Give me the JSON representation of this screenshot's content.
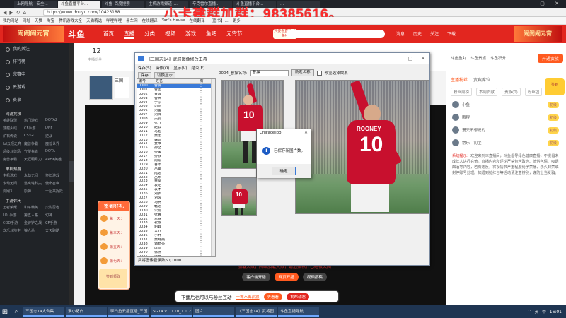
{
  "browser": {
    "tabs": [
      "上网导航—安全...",
      "斗鱼直播平台...",
      "斗鱼_百度搜索",
      "主机游戏频道_...",
      "辛克雷尔直播...",
      "斗鱼直播平台...",
      "..."
    ],
    "active_tab_index": 1,
    "url": "https://www.douyu.com/10423188",
    "nav_back": "◀",
    "nav_fwd": "▶",
    "nav_refresh": "↻",
    "nav_home": "⌂",
    "window_controls": "— ▢ ✕"
  },
  "overlay_text": "小卡建群加群：98385616。",
  "bookmarks": [
    "我的网站",
    "网址",
    "天猫",
    "淘宝",
    "腾讯游戏大全",
    "天猫精选",
    "哔哩哔哩",
    "易车网",
    "在线翻译",
    "Yan's House",
    "在线翻译",
    "【图书】...",
    "更多"
  ],
  "header": {
    "logo": "斗鱼",
    "nav": [
      "首页",
      "直播",
      "分类",
      "视频",
      "游戏",
      "鱼吧",
      "元宵节"
    ],
    "active_nav_index": 1,
    "badge": "只要看直播 上鱼吧",
    "icons": [
      "消息",
      "历史",
      "关注",
      "下载"
    ],
    "banner_left": "闹闹闹元宵",
    "banner_right": "闹闹闹元宵"
  },
  "sidebar": {
    "items": [
      "我的关注",
      "排行榜",
      "完赛中",
      "云游戏",
      "赛事"
    ],
    "section1": "网游竞技",
    "grid1": [
      "英雄联盟",
      "热门游戏",
      "DOTA2",
      "穿越火线",
      "CF手游",
      "DNF",
      "炉石传说",
      "CS:GO",
      "逆战",
      "lol云顶之弈",
      "魔兽争霸",
      "魔兽世界",
      "超级斗兽场",
      "守望先锋",
      "DOTA",
      "魔兽争霸",
      "天涯明月刀",
      "APEX英雄"
    ],
    "section2": "单机热游",
    "grid2": [
      "主机游戏",
      "永劫无间",
      "怀旧游戏",
      "永劫无间",
      "逃离塔科夫",
      "使命召唤",
      "剑网3",
      "原神",
      "一起来捉妖"
    ],
    "section3": "手游休闲",
    "grid3": [
      "王者荣耀",
      "和平精英",
      "火影忍者",
      "LOL手游",
      "第五人格",
      "幻神",
      "COD手游",
      "金铲铲之战",
      "CF手游",
      "欢乐斗地主",
      "狼人杀",
      "天天跑酷"
    ]
  },
  "stream": {
    "fans_count": "12",
    "fans_label": "主播粉丝",
    "thumb_label": "三国"
  },
  "signin": {
    "title": "签到好礼",
    "rows": [
      "第一天：",
      "第三天：",
      "第五天：",
      "第七天："
    ],
    "gift": "签到领取"
  },
  "bottom": {
    "message": "加载失败，网络加载失败，请选择软件已经被关闭",
    "btn1": "客户端开播",
    "btn2": "网页开播",
    "btn3": "视频投稿"
  },
  "promo": {
    "text": "下播后也可以与粉丝互动",
    "link": "一城不再孤独",
    "btn1": "去看看",
    "btn2": "发布动态"
  },
  "right": {
    "top_labels": [
      "斗鱼鱼丸",
      "斗鱼贵族",
      "斗鱼积分"
    ],
    "open_btn": "开通贵族",
    "tabs": [
      "主播粉丝",
      "贵宾席位"
    ],
    "subtabs": [
      "粉丝周榜",
      "本周贡献",
      "贵族(0)",
      "粉丝团"
    ],
    "users": [
      {
        "name": "小鱼",
        "level": "初级"
      },
      {
        "name": "鹏程",
        "level": "初级"
      },
      {
        "name": "漫天不想说的",
        "level": "初级"
      },
      {
        "name": "常乐—初尘",
        "level": "初级"
      }
    ],
    "notice_title": "系统提示：",
    "notice": "欢迎来到本直播间，斗鱼倡导绿色健康直播，不提倡未成年人进行充值。直播内容和评论严禁包含政治、低俗色情、吸烟酗酒等内容，若有违反，将视情节严重程度给予禁播、永久封禁或封停账号处理。如遇到抢红包等活动请注意辨别，谨防上当受骗。",
    "badge": "签到"
  },
  "dialog": {
    "title": "《三国志14》武将图像修改工具",
    "menu": [
      "保存(S)",
      "操作(O)",
      "显示(V)",
      "结束(E)"
    ],
    "toolbar": [
      "保存",
      "切换显示"
    ],
    "columns": [
      "编号",
      "姓名",
      "有"
    ],
    "rows": [
      [
        "0000",
        "曹操",
        "○"
      ],
      [
        "0001",
        "曹丕",
        "○"
      ],
      [
        "0002",
        "曹叡",
        "○"
      ],
      [
        "0003",
        "曹奂",
        "○"
      ],
      [
        "0004",
        "于禁",
        "○"
      ],
      [
        "0005",
        "司马",
        "○"
      ],
      [
        "0006",
        "刘备",
        "○"
      ],
      [
        "0007",
        "刘禅",
        "○"
      ],
      [
        "0008",
        "关羽",
        "○"
      ],
      [
        "0009",
        "张飞",
        "○"
      ],
      [
        "0010",
        "赵云",
        "○"
      ],
      [
        "0011",
        "马超",
        "○"
      ],
      [
        "0012",
        "黄忠",
        "○"
      ],
      [
        "0013",
        "魏延",
        "○"
      ],
      [
        "0014",
        "姜维",
        "○"
      ],
      [
        "0015",
        "孙坚",
        "○"
      ],
      [
        "0016",
        "孙策",
        "○"
      ],
      [
        "0017",
        "孙权",
        "○"
      ],
      [
        "0018",
        "周瑜",
        "○"
      ],
      [
        "0019",
        "鲁肃",
        "○"
      ],
      [
        "0020",
        "吕蒙",
        "○"
      ],
      [
        "0021",
        "陆逊",
        "○"
      ],
      [
        "0022",
        "吕布",
        "○"
      ],
      [
        "0023",
        "董卓",
        "○"
      ],
      [
        "0024",
        "袁绍",
        "○"
      ],
      [
        "0025",
        "袁术",
        "○"
      ],
      [
        "0026",
        "刘表",
        "○"
      ],
      [
        "0027",
        "刘璋",
        "○"
      ],
      [
        "0028",
        "马腾",
        "○"
      ],
      [
        "0029",
        "韩遂",
        "○"
      ],
      [
        "0030",
        "公孙",
        "○"
      ],
      [
        "0031",
        "张鲁",
        "○"
      ],
      [
        "0032",
        "孟获",
        "○"
      ],
      [
        "0033",
        "祝融",
        "○"
      ],
      [
        "0034",
        "貂蝉",
        "○"
      ],
      [
        "0035",
        "大乔",
        "○"
      ],
      [
        "0036",
        "小乔",
        "○"
      ],
      [
        "0037",
        "黄月英",
        "○"
      ],
      [
        "0038",
        "诸葛亮",
        "○"
      ],
      [
        "0039",
        "庞统",
        "○"
      ],
      [
        "0040",
        "徐庶",
        "○"
      ],
      [
        "0041",
        "郭嘉",
        "○"
      ],
      [
        "0042",
        "荀彧",
        "○"
      ],
      [
        "0043",
        "贾诩",
        "○"
      ],
      [
        "0044",
        "程昱",
        "○"
      ],
      [
        "0045",
        "荀攸",
        "○"
      ]
    ],
    "selected_row": 0,
    "status": "武将图像登录数60/1000",
    "current_label": "0004_曹操名称:",
    "name_value": "曹操",
    "btn_set_name": "设定名称",
    "checkbox_label": "预览选择效果",
    "jersey_number": "10",
    "jersey_name": "ROONEY"
  },
  "msgbox": {
    "title": "ChiFaceTool",
    "close": "✕",
    "icon": "i",
    "text": "已保存新图片数。",
    "ok": "确定"
  },
  "taskbar": {
    "items": [
      "三国志14大合集",
      "淮小猪白",
      "李白鱼云播直播_三国...",
      "SG14 v1.0.10_1.0.23",
      "图片",
      "《三国志14》武将图...",
      "斗鱼直播导航"
    ],
    "tray": [
      "^",
      "英",
      "中"
    ],
    "clock": "16:01"
  },
  "colors": {
    "brand": "#e2261f",
    "accent": "#ff5a1f",
    "jersey": "#c8102e"
  }
}
